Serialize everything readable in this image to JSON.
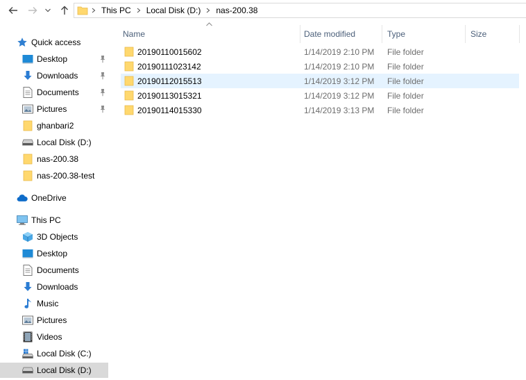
{
  "breadcrumbs": [
    "This PC",
    "Local Disk (D:)",
    "nas-200.38"
  ],
  "navigation": {
    "quick_access": {
      "label": "Quick access",
      "items": [
        {
          "label": "Desktop",
          "icon": "desktop-icon",
          "pinned": true
        },
        {
          "label": "Downloads",
          "icon": "downloads-icon",
          "pinned": true
        },
        {
          "label": "Documents",
          "icon": "documents-icon",
          "pinned": true
        },
        {
          "label": "Pictures",
          "icon": "pictures-icon",
          "pinned": true
        },
        {
          "label": "ghanbari2",
          "icon": "folder-icon",
          "pinned": false
        },
        {
          "label": "Local Disk (D:)",
          "icon": "drive-icon",
          "pinned": false
        },
        {
          "label": "nas-200.38",
          "icon": "folder-icon",
          "pinned": false
        },
        {
          "label": "nas-200.38-test",
          "icon": "folder-icon",
          "pinned": false
        }
      ]
    },
    "onedrive": {
      "label": "OneDrive"
    },
    "this_pc": {
      "label": "This PC",
      "items": [
        {
          "label": "3D Objects",
          "icon": "3d-objects-icon"
        },
        {
          "label": "Desktop",
          "icon": "desktop-icon"
        },
        {
          "label": "Documents",
          "icon": "documents-icon"
        },
        {
          "label": "Downloads",
          "icon": "downloads-icon"
        },
        {
          "label": "Music",
          "icon": "music-icon"
        },
        {
          "label": "Pictures",
          "icon": "pictures-icon"
        },
        {
          "label": "Videos",
          "icon": "videos-icon"
        },
        {
          "label": "Local Disk (C:)",
          "icon": "os-drive-icon"
        },
        {
          "label": "Local Disk (D:)",
          "icon": "drive-icon",
          "selected": true
        }
      ]
    }
  },
  "columns": {
    "name": "Name",
    "date": "Date modified",
    "type": "Type",
    "size": "Size"
  },
  "files": [
    {
      "name": "20190110015602",
      "date": "1/14/2019 2:10 PM",
      "type": "File folder",
      "selected": false
    },
    {
      "name": "20190111023142",
      "date": "1/14/2019 2:10 PM",
      "type": "File folder",
      "selected": false
    },
    {
      "name": "20190112015513",
      "date": "1/14/2019 3:12 PM",
      "type": "File folder",
      "selected": true
    },
    {
      "name": "20190113015321",
      "date": "1/14/2019 3:12 PM",
      "type": "File folder",
      "selected": false
    },
    {
      "name": "20190114015330",
      "date": "1/14/2019 3:13 PM",
      "type": "File folder",
      "selected": false
    }
  ],
  "colors": {
    "folder": "#ffd86e",
    "folder_dark": "#e8b94a",
    "selection": "#e5f3ff",
    "nav_selected": "#d9d9d9",
    "header_text": "#4c607a"
  }
}
